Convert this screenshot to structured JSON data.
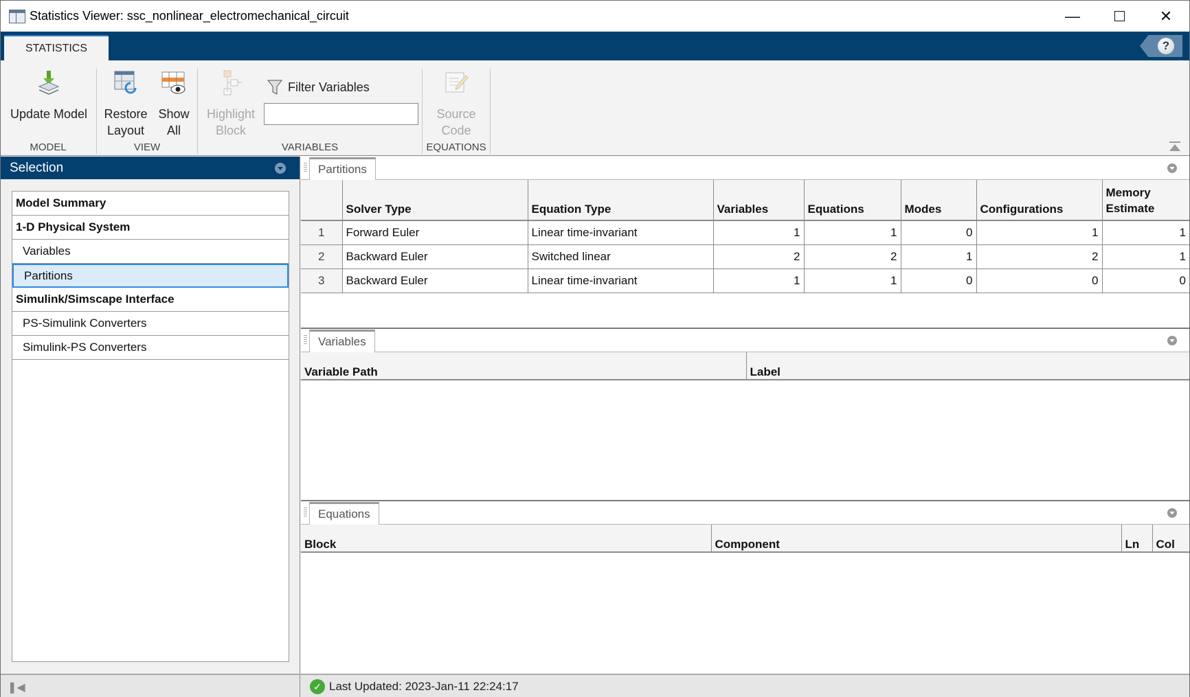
{
  "window": {
    "title": "Statistics Viewer: ssc_nonlinear_electromechanical_circuit",
    "minimize_icon": "minimize-icon",
    "maximize_icon": "maximize-icon",
    "close_icon": "close-icon"
  },
  "toolstrip": {
    "tab": "STATISTICS",
    "help_icon": "help-icon",
    "groups": {
      "model": {
        "label": "MODEL",
        "update_model": "Update Model"
      },
      "view": {
        "label": "VIEW",
        "restore_1": "Restore",
        "restore_2": "Layout",
        "show_1": "Show",
        "show_2": "All"
      },
      "variables": {
        "label": "VARIABLES",
        "highlight_1": "Highlight",
        "highlight_2": "Block",
        "filter_label": "Filter Variables",
        "filter_value": "",
        "filter_placeholder": ""
      },
      "equations": {
        "label": "EQUATIONS",
        "source_1": "Source",
        "source_2": "Code"
      }
    }
  },
  "selection": {
    "title": "Selection",
    "items": [
      {
        "label": "Model Summary",
        "level": 0
      },
      {
        "label": "1-D Physical System",
        "level": 0
      },
      {
        "label": "Variables",
        "level": 1
      },
      {
        "label": "Partitions",
        "level": 1,
        "selected": true
      },
      {
        "label": "Simulink/Simscape Interface",
        "level": 0
      },
      {
        "label": "PS-Simulink Converters",
        "level": 1
      },
      {
        "label": "Simulink-PS Converters",
        "level": 1
      }
    ]
  },
  "partitions": {
    "tab": "Partitions",
    "columns": [
      "",
      "Solver Type",
      "Equation Type",
      "Variables",
      "Equations",
      "Modes",
      "Configurations",
      "Memory",
      "Estimate"
    ],
    "rows": [
      [
        "1",
        "Forward Euler",
        "Linear time-invariant",
        "1",
        "1",
        "0",
        "1",
        "1"
      ],
      [
        "2",
        "Backward Euler",
        "Switched linear",
        "2",
        "2",
        "1",
        "2",
        "1"
      ],
      [
        "3",
        "Backward Euler",
        "Linear time-invariant",
        "1",
        "1",
        "0",
        "0",
        "0"
      ]
    ]
  },
  "variables": {
    "tab": "Variables",
    "columns": [
      "Variable Path",
      "Label"
    ]
  },
  "equations": {
    "tab": "Equations",
    "columns": [
      "Block",
      "Component",
      "Ln",
      "Col"
    ]
  },
  "status": {
    "text": "Last Updated: 2023-Jan-11 22:24:17",
    "icon": "check-circle-icon"
  }
}
